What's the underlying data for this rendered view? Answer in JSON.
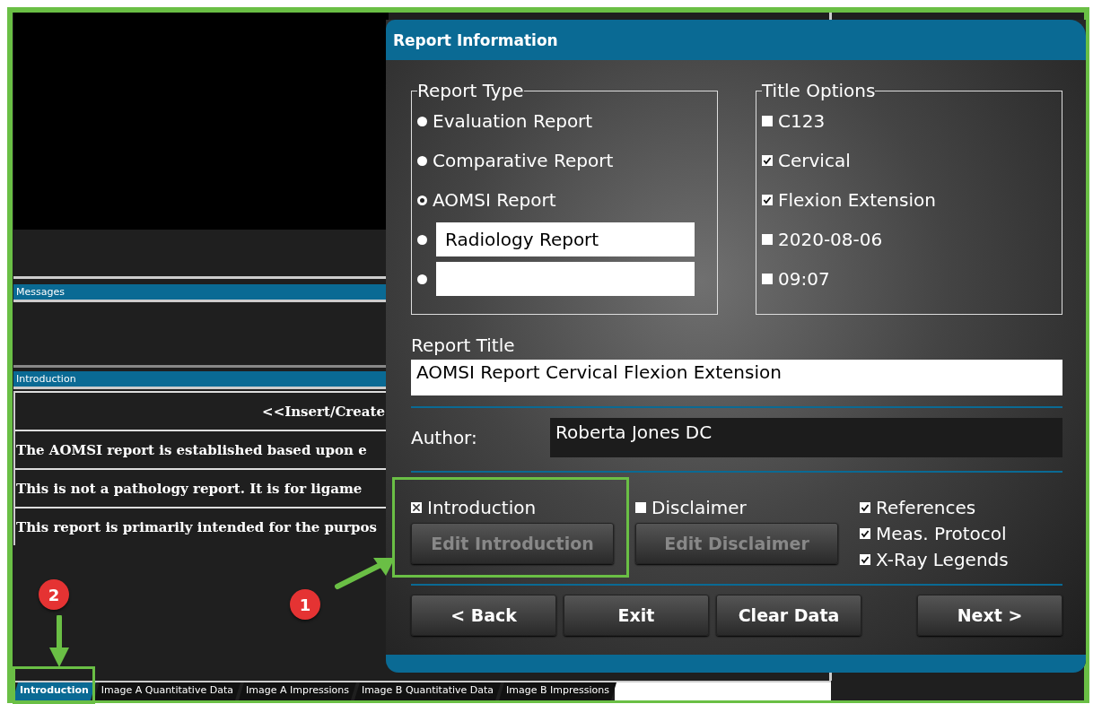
{
  "left_panel": {
    "messages_header": "Messages",
    "introduction_header": "Introduction",
    "intro_rows": [
      {
        "kind": "heading",
        "text": "<<Insert/Create"
      },
      {
        "kind": "body",
        "text": "The AOMSI report is established based upon e"
      },
      {
        "kind": "body",
        "text": "This is not a pathology report.  It is for ligame"
      },
      {
        "kind": "body",
        "text": "This report is primarily intended for the purpos"
      }
    ]
  },
  "window": {
    "title": "Report Information"
  },
  "report_type": {
    "legend": "Report Type",
    "options": [
      {
        "kind": "label",
        "label": "Evaluation Report",
        "selected": false
      },
      {
        "kind": "label",
        "label": "Comparative Report",
        "selected": false
      },
      {
        "kind": "label",
        "label": "AOMSI Report",
        "selected": true
      },
      {
        "kind": "field",
        "value": "Radiology Report",
        "selected": false
      },
      {
        "kind": "field",
        "selected": false
      }
    ]
  },
  "title_options": {
    "legend": "Title Options",
    "items": [
      {
        "label": "C123",
        "checked": false
      },
      {
        "label": "Cervical",
        "checked": true
      },
      {
        "label": "Flexion Extension",
        "checked": true
      },
      {
        "label": "2020-08-06",
        "checked": false
      },
      {
        "label": "09:07",
        "checked": false
      }
    ]
  },
  "report_title": {
    "label": "Report Title",
    "value": "AOMSI Report Cervical Flexion Extension"
  },
  "author": {
    "label": "Author:",
    "value": "Roberta Jones DC"
  },
  "sections": [
    {
      "label": "Introduction",
      "checked": true,
      "button": "Edit Introduction",
      "button_disabled": true
    },
    {
      "label": "Disclaimer",
      "checked": false,
      "button": "Edit Disclaimer",
      "button_disabled": true
    }
  ],
  "extras": [
    {
      "label": "References",
      "checked": true
    },
    {
      "label": "Meas. Protocol",
      "checked": true
    },
    {
      "label": "X-Ray Legends",
      "checked": true
    }
  ],
  "buttons": [
    "< Back",
    "Exit",
    "Clear Data",
    "Next >"
  ],
  "tabs": [
    {
      "label": "Introduction",
      "selected": true
    },
    {
      "label": "Image A Quantitative Data",
      "selected": false
    },
    {
      "label": "Image A Impressions",
      "selected": false
    },
    {
      "label": "Image B Quantitative Data",
      "selected": false
    },
    {
      "label": "Image B Impressions",
      "selected": false
    }
  ],
  "callouts": [
    {
      "label": "1"
    },
    {
      "label": "2"
    }
  ]
}
